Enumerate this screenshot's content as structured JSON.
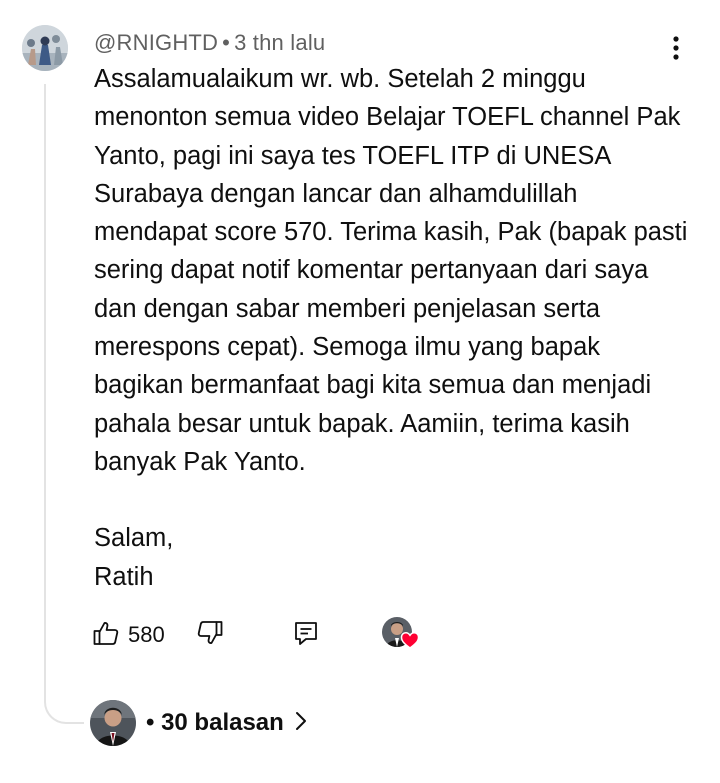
{
  "comment": {
    "author": "@RNIGHTD",
    "separator": "•",
    "time": "3 thn lalu",
    "text": "Assalamualaikum wr. wb. Setelah 2 minggu menonton semua video Belajar TOEFL channel Pak Yanto, pagi ini saya tes TOEFL ITP di UNESA Surabaya dengan lancar dan alhamdulillah mendapat score 570. Terima kasih, Pak (bapak pasti sering dapat notif komentar pertanyaan dari saya dan dengan sabar memberi penjelasan serta merespons cepat). Semoga ilmu yang bapak bagikan bermanfaat bagi kita semua dan menjadi pahala besar untuk bapak. Aamiin, terima kasih banyak Pak Yanto.",
    "closing": "Salam,",
    "signature": "Ratih"
  },
  "actions": {
    "like_count": "580"
  },
  "replies": {
    "label": "• 30 balasan"
  },
  "colors": {
    "text": "#0f0f0f",
    "meta": "#606060",
    "thread_line": "#e3e3e3",
    "heart": "#ff0033"
  },
  "icons": {
    "more": "more-vert-icon",
    "like": "thumbs-up-icon",
    "dislike": "thumbs-down-icon",
    "reply": "reply-comment-icon",
    "heart": "creator-heart-icon",
    "chevron": "chevron-right-icon"
  }
}
